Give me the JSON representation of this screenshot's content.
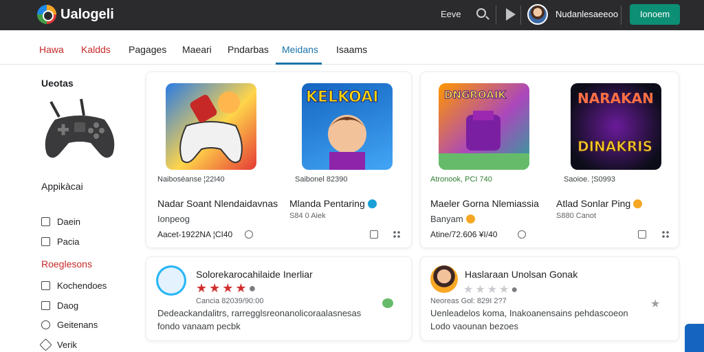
{
  "header": {
    "brand": "Ualogeli",
    "link": "Eeve",
    "user_name": "Nudanlesaeeoo",
    "cta_label": "Ionoem"
  },
  "tabs": [
    {
      "label": "Hawa"
    },
    {
      "label": "Kaldds"
    },
    {
      "label": "Pagages"
    },
    {
      "label": "Maeari"
    },
    {
      "label": "Pndarbas"
    },
    {
      "label": "Meidans"
    },
    {
      "label": "Isaams"
    }
  ],
  "sidebar": {
    "heading1": "Ueotas",
    "heading2": "Appikàcai",
    "items1": [
      {
        "label": "Daein"
      },
      {
        "label": "Pacia"
      }
    ],
    "heading3": "Roeglesons",
    "items2": [
      {
        "label": "Kochendoes"
      },
      {
        "label": "Daog"
      },
      {
        "label": "Geitenans"
      },
      {
        "label": "Verik"
      }
    ]
  },
  "apps": [
    {
      "art": "",
      "meta": "Naiboséanse ¦22I40",
      "title": "Nadar Soant Nlendaidavnas",
      "sub": "Ionpeog",
      "price": "Aacet-1922NA ¦CI40"
    },
    {
      "art": "KELKOAI",
      "meta": "Saibonel 82390",
      "title": "Mlanda Pentaring",
      "sub": "S84 0 Aiek",
      "price": ""
    },
    {
      "art": "DNGROAIK",
      "meta": "Atronook, PCI 740",
      "title": "Maeler Gorna Nlemiassia",
      "sub": "Banyam",
      "price": "Atine/72.606 ¥I/40"
    },
    {
      "art": "NARAKAN",
      "art2": "DINAKRIS",
      "meta": "Saoioe. ¦S0993",
      "title": "Atlad Sonlar Ping",
      "sub": "S880 Canot",
      "price": ""
    }
  ],
  "reviews": [
    {
      "title": "Solorekarocahilaide Inerliar",
      "meta": "Cancia 82039/90:00",
      "body1": "Dedeackandalitrs, rarregglsreonanolicoraalasnesas",
      "body2": "fondo vanaam pecbk"
    },
    {
      "title": "Haslaraan Unolsan Gonak",
      "meta": "Neoreas Gol: 829I 2?7",
      "body1": "Uenleadelos koma, Inakoanensains pehdascoeon",
      "body2": "Lodo vaounan bezoes"
    }
  ],
  "colors": {
    "accent": "#1a73a8",
    "cta": "#0c8f74",
    "topbar": "#2b2b2d",
    "star": "#d32f2f",
    "alert": "#c62828"
  }
}
